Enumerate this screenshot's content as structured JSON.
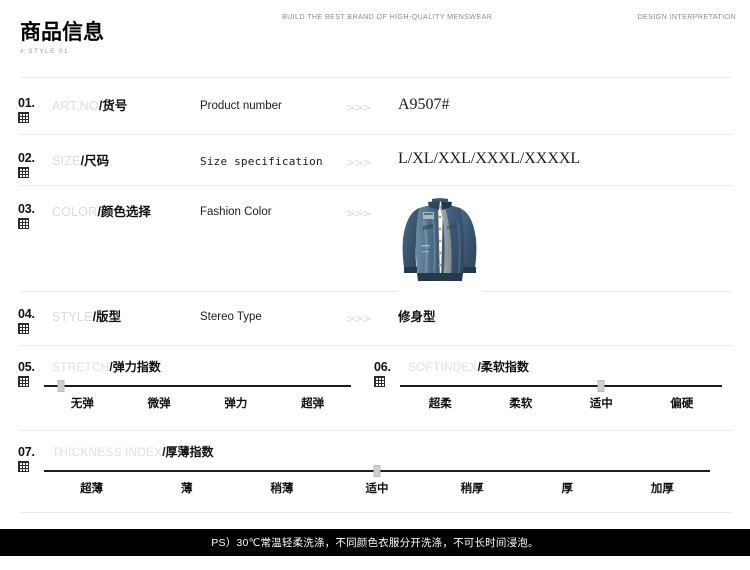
{
  "header": {
    "tagline": "BUILD THE BEST BRAND OF HIGH-QUALITY MENSWEAR",
    "design_note": "DESIGN INTERPRETATION",
    "title": "商品信息",
    "subtitle": "# STYLE 01"
  },
  "rows": [
    {
      "number": "01.",
      "label_en": "ART.NO",
      "label_cn": "/货号",
      "mid": "Product number",
      "chevron": ">>>",
      "value": "A9507#"
    },
    {
      "number": "02.",
      "label_en": "SIZE",
      "label_cn": "/尺码",
      "mid": "Size specification",
      "chevron": ">>>",
      "value": "L/XL/XXL/XXXL/XXXXL"
    },
    {
      "number": "03.",
      "label_en": "COLOR",
      "label_cn": "/颜色选择",
      "mid": "Fashion Color",
      "chevron": ">>>",
      "value": ""
    },
    {
      "number": "04.",
      "label_en": "STYLE",
      "label_cn": "/版型",
      "mid": "Stereo Type",
      "chevron": ">>>",
      "value": "修身型"
    }
  ],
  "product_image": {
    "alt": "denim-jacket",
    "colors": {
      "denim_dark": "#2d4356",
      "denim_mid": "#44627d",
      "denim_light": "#6b89a4",
      "denim_worn": "#8aa3b8",
      "lining": "#9aa9ad",
      "button": "#c9a24a"
    }
  },
  "sliders": [
    {
      "number": "05.",
      "label_en": "STRETCH",
      "label_cn": "/弹力指数",
      "ticks": [
        "无弹",
        "微弹",
        "弹力",
        "超弹"
      ],
      "selected_index": 0,
      "selected_label": "无弹"
    },
    {
      "number": "06.",
      "label_en": "SOFTINDEX",
      "label_cn": "/柔软指数",
      "ticks": [
        "超柔",
        "柔软",
        "适中",
        "偏硬"
      ],
      "selected_index": 2,
      "selected_label": "适中"
    },
    {
      "number": "07.",
      "label_en": "THICKNESS INDEX",
      "label_cn": "/厚薄指数",
      "ticks": [
        "超薄",
        "薄",
        "稍薄",
        "适中",
        "稍厚",
        "厚",
        "加厚"
      ],
      "selected_index": 3,
      "selected_label": "适中"
    }
  ],
  "footer": {
    "note": "PS）30℃常温轻柔洗涤，不同颜色衣服分开洗涤，不可长时间浸泡。"
  }
}
